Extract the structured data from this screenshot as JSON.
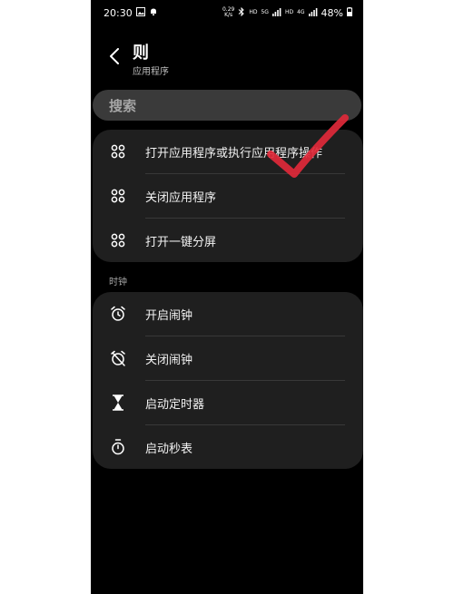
{
  "status_bar": {
    "time": "20:30",
    "net_speed_value": "0.29",
    "net_speed_unit": "K/s",
    "hd_label": "HD",
    "signal_5g_label": "5G",
    "hd2_label": "HD",
    "signal_4g_label": "4G",
    "battery_percent": "48%"
  },
  "header": {
    "title": "则",
    "subtitle": "应用程序"
  },
  "search": {
    "placeholder": "搜索"
  },
  "apps_section": {
    "items": [
      {
        "label": "打开应用程序或执行应用程序操作",
        "icon": "apps-grid-icon"
      },
      {
        "label": "关闭应用程序",
        "icon": "apps-grid-icon"
      },
      {
        "label": "打开一键分屏",
        "icon": "apps-grid-icon"
      }
    ]
  },
  "clock_section": {
    "header": "时钟",
    "items": [
      {
        "label": "开启闹钟",
        "icon": "alarm-icon"
      },
      {
        "label": "关闭闹钟",
        "icon": "alarm-off-icon"
      },
      {
        "label": "启动定时器",
        "icon": "hourglass-icon"
      },
      {
        "label": "启动秒表",
        "icon": "stopwatch-icon"
      }
    ]
  },
  "colors": {
    "background": "#000000",
    "card": "#1f1f1f",
    "search_bg": "#3a3a3a",
    "annotation_red": "#e0293a"
  }
}
